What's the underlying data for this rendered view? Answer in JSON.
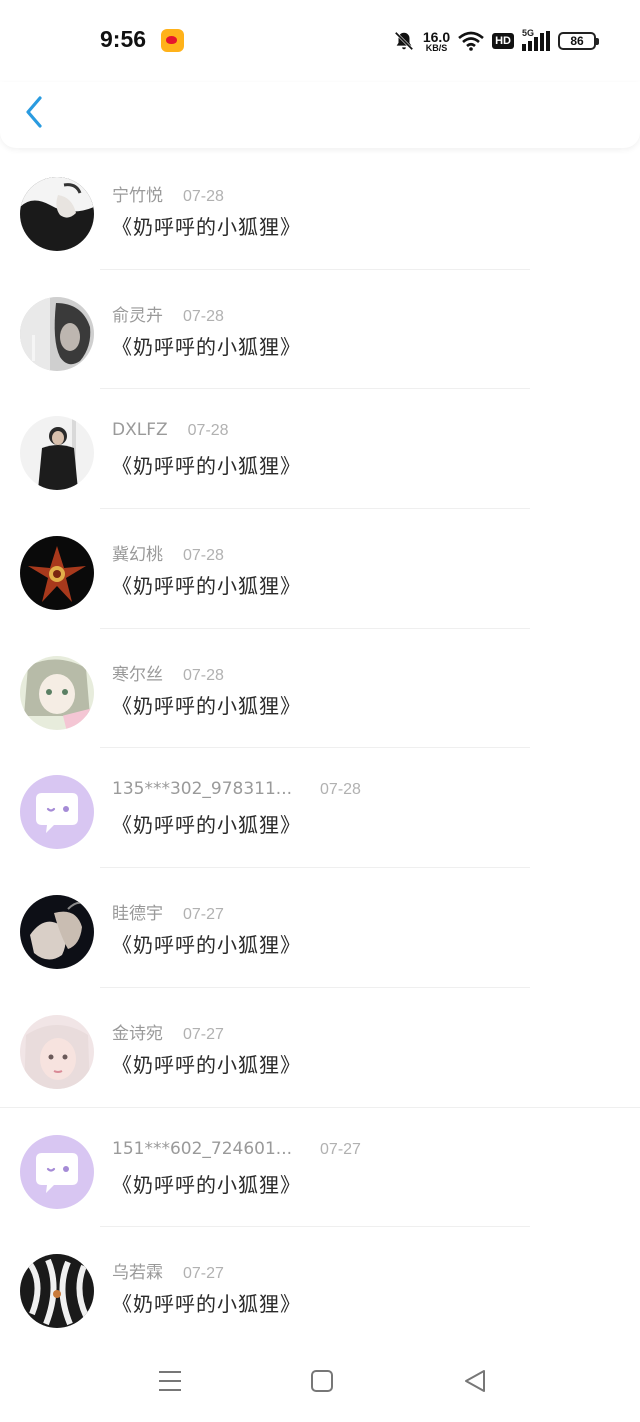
{
  "status_bar": {
    "time": "9:56",
    "speed_value": "16.0",
    "speed_unit": "KB/S",
    "hd_label": "HD",
    "network_label": "5G",
    "battery_level": "86"
  },
  "messages": [
    {
      "name": "宁竹悦",
      "date": "07-28",
      "text": "《奶呼呼的小狐狸》",
      "avatar": "photo-dark-hand"
    },
    {
      "name": "俞灵卉",
      "date": "07-28",
      "text": "《奶呼呼的小狐狸》",
      "avatar": "photo-grey-portrait"
    },
    {
      "name": "DXLFZ",
      "date": "07-28",
      "text": "《奶呼呼的小狐狸》",
      "avatar": "photo-man-black-coat"
    },
    {
      "name": "冀幻桃",
      "date": "07-28",
      "text": "《奶呼呼的小狐狸》",
      "avatar": "photo-orchid-flower"
    },
    {
      "name": "寒尔丝",
      "date": "07-28",
      "text": "《奶呼呼的小狐狸》",
      "avatar": "anime-girl"
    },
    {
      "name": "135***302_978311...",
      "date": "07-28",
      "text": "《奶呼呼的小狐狸》",
      "avatar": "default-chat-bubble"
    },
    {
      "name": "眭德宇",
      "date": "07-27",
      "text": "《奶呼呼的小狐狸》",
      "avatar": "photo-smoke-portrait"
    },
    {
      "name": "金诗宛",
      "date": "07-27",
      "text": "《奶呼呼的小狐狸》",
      "avatar": "photo-pink-girl"
    },
    {
      "name": "151***602_724601...",
      "date": "07-27",
      "text": "《奶呼呼的小狐狸》",
      "avatar": "default-chat-bubble"
    },
    {
      "name": "乌若霖",
      "date": "07-27",
      "text": "《奶呼呼的小狐狸》",
      "avatar": "photo-bw-pattern"
    }
  ],
  "colors": {
    "accent": "#2a9be0",
    "default_avatar_bg": "#d8c6f2",
    "name_text": "#9a9a9a",
    "date_text": "#b1b1b1"
  },
  "icons": {
    "back": "back-chevron-icon",
    "nav_menu": "menu-icon",
    "nav_home": "home-icon",
    "nav_back": "back-triangle-icon"
  }
}
